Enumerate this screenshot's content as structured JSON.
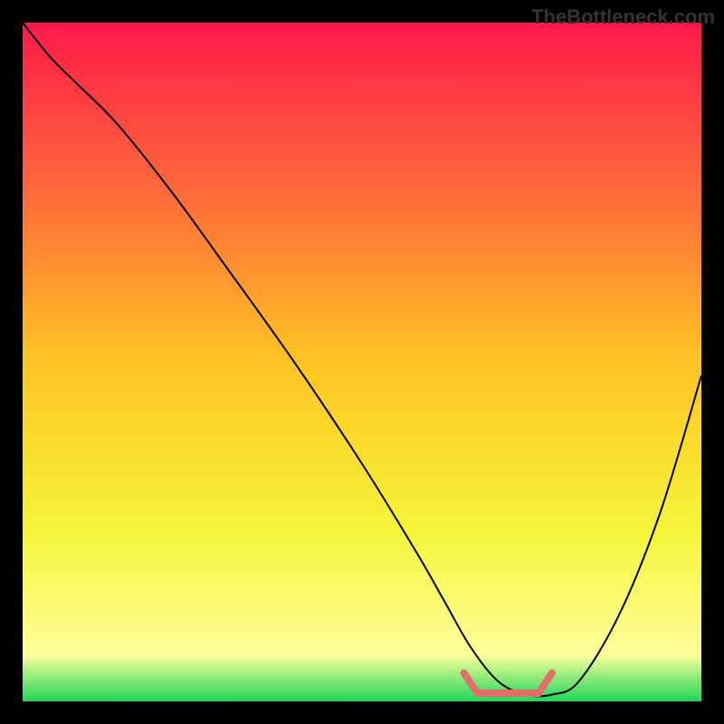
{
  "watermark": "TheBottleneck.com",
  "chart_data": {
    "type": "line",
    "title": "",
    "xlabel": "",
    "ylabel": "",
    "xlim": [
      0,
      100
    ],
    "ylim": [
      0,
      100
    ],
    "gradient_stops": [
      {
        "offset": 0,
        "color": "#ff1a4a"
      },
      {
        "offset": 25,
        "color": "#ff6a3a"
      },
      {
        "offset": 50,
        "color": "#ffc423"
      },
      {
        "offset": 75,
        "color": "#f5f53a"
      },
      {
        "offset": 93,
        "color": "#ffff9a"
      },
      {
        "offset": 100,
        "color": "#1fd65a"
      }
    ],
    "series": [
      {
        "name": "bottleneck-curve",
        "color": "#000000",
        "x": [
          0,
          4,
          8,
          14,
          22,
          30,
          40,
          50,
          58,
          62,
          66,
          70,
          74,
          78,
          82,
          88,
          94,
          100
        ],
        "y": [
          100,
          95,
          91,
          85,
          75,
          64,
          50,
          35,
          22,
          15,
          8,
          3,
          1,
          1,
          3,
          13,
          28,
          48
        ]
      }
    ],
    "optimal_zone": {
      "x_start": 65,
      "x_end": 78,
      "y": 1.2,
      "color": "#e2706a"
    }
  }
}
